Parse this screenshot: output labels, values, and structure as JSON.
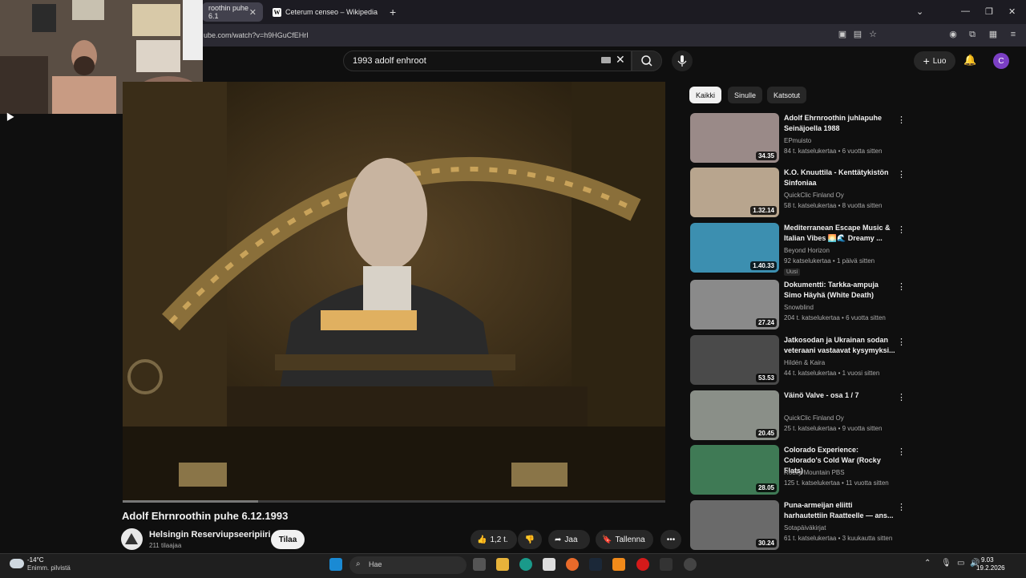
{
  "browser": {
    "tabs": [
      {
        "label": "roothin puhe 6.1"
      },
      {
        "label": "Ceterum censeo – Wikipedia"
      }
    ],
    "url": "ube.com/watch?v=h9HGuCfEHrI"
  },
  "youtube": {
    "search_value": "1993 adolf enhroot",
    "create_label": "Luo",
    "avatar_letter": "C"
  },
  "video": {
    "title": "Adolf Ehrnroothin puhe 6.12.1993",
    "channel": "Helsingin Reserviupseeripiiri",
    "subscribers": "211 tilaajaa",
    "subscribe_label": "Tilaa",
    "likes": "1,2 t.",
    "share_label": "Jaa",
    "save_label": "Tallenna",
    "progress": 0.25
  },
  "sidebar": {
    "chips": [
      "Kaikki",
      "Sinulle",
      "Katsotut"
    ],
    "recommendations": [
      {
        "title": "Adolf Ehrnroothin juhlapuhe Seinäjoella 1988",
        "channel": "EPmuisto",
        "meta": "84 t. katselukertaa • 6 vuotta sitten",
        "duration": "34.35",
        "color": "#9a8a88"
      },
      {
        "title": "K.O. Knuuttila - Kenttätykistön Sinfoniaa",
        "channel": "QuickClic Finland Oy",
        "meta": "58 t. katselukertaa • 8 vuotta sitten",
        "duration": "1.32.14",
        "color": "#b8a58e"
      },
      {
        "title": "Mediterranean Escape Music & Italian Vibes 🌅🌊 Dreamy ...",
        "channel": "Beyond Horizon",
        "meta": "92 katselukertaa • 1 päivä sitten",
        "duration": "1.40.33",
        "color": "#3c8fb0",
        "badge": "Uusi"
      },
      {
        "title": "Dokumentti: Tarkka-ampuja Simo Häyhä (White Death)",
        "channel": "Snowblind",
        "meta": "204 t. katselukertaa • 6 vuotta sitten",
        "duration": "27.24",
        "color": "#8a8a8a"
      },
      {
        "title": "Jatkosodan ja Ukrainan sodan veteraani vastaavat kysymyksi...",
        "channel": "Hildén & Kaira",
        "meta": "44 t. katselukertaa • 1 vuosi sitten",
        "duration": "53.53",
        "color": "#4a4a4a"
      },
      {
        "title": "Väinö Valve - osa 1 / 7",
        "channel": "QuickClic Finland Oy",
        "meta": "25 t. katselukertaa • 9 vuotta sitten",
        "duration": "20.45",
        "color": "#8a8f88"
      },
      {
        "title": "Colorado Experience: Colorado's Cold War (Rocky Flats)",
        "channel": "Rocky Mountain PBS",
        "meta": "125 t. katselukertaa • 11 vuotta sitten",
        "duration": "28.05",
        "color": "#3f7a55"
      },
      {
        "title": "Puna-armeijan eliitti harhautettiin Raatteelle — ans...",
        "channel": "Sotapäiväkirjat",
        "meta": "61 t. katselukertaa • 3 kuukautta sitten",
        "duration": "30.24",
        "color": "#6a6a6a"
      }
    ]
  },
  "taskbar": {
    "weather_temp": "-14°C",
    "weather_desc": "Enimm. pilvistä",
    "search_label": "Hae",
    "time": "9.03",
    "date": "19.2.2026"
  }
}
